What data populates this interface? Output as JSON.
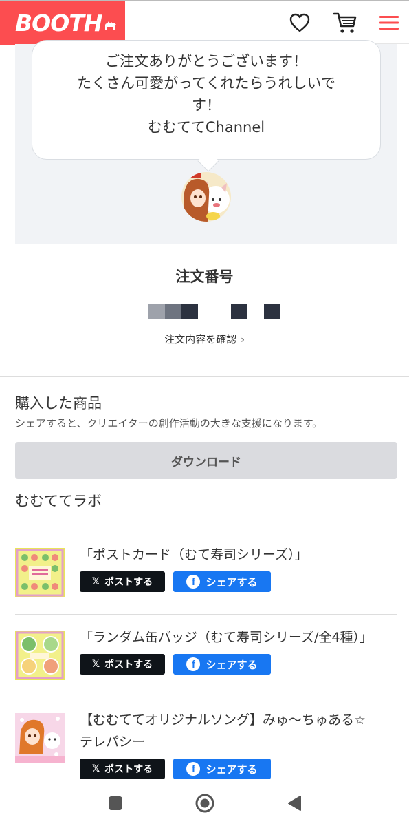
{
  "header": {
    "logo_text": "BOOTH",
    "brand_color": "#fc4d50",
    "icons": [
      "heart-icon",
      "cart-icon",
      "menu-icon"
    ]
  },
  "thanks": {
    "message_lines": [
      "ご注文ありがとうございます！",
      "たくさん可愛がってくれたらうれしいで",
      "す！",
      "むむててChannel"
    ]
  },
  "order": {
    "title": "注文番号",
    "link_label": "注文内容を確認"
  },
  "purchased": {
    "title": "購入した商品",
    "subtitle": "シェアすると、クリエイターの創作活動の大きな支援になります。",
    "download_label": "ダウンロード",
    "shop_name": "むむててラボ",
    "items": [
      {
        "title": "「ポストカード（むて寿司シリーズ）」",
        "post_label": "ポストする",
        "share_label": "シェアする"
      },
      {
        "title": "「ランダム缶バッジ（むて寿司シリーズ/全4種）」",
        "post_label": "ポストする",
        "share_label": "シェアする"
      },
      {
        "title_line1": "【むむててオリジナルソング】みゅ〜ちゅある☆",
        "title_line2": "テレパシー",
        "post_label": "ポストする",
        "share_label": "シェアする"
      }
    ]
  },
  "colors": {
    "x_button": "#0f1419",
    "facebook_button": "#1877f2",
    "download_button": "#dadbdf"
  }
}
